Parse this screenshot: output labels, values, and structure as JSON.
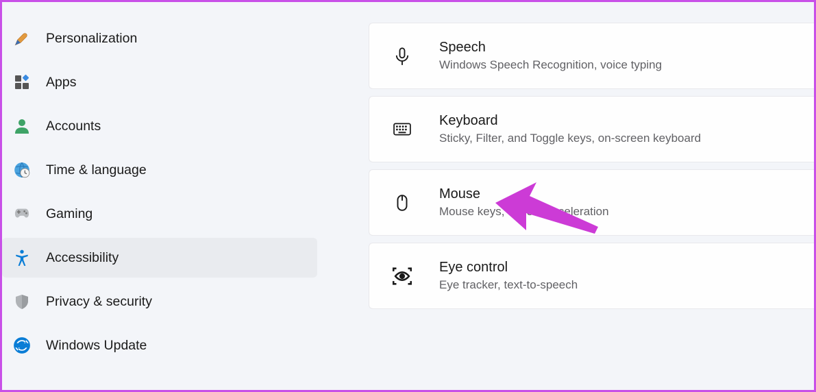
{
  "sidebar": {
    "items": [
      {
        "label": "Personalization",
        "selected": false
      },
      {
        "label": "Apps",
        "selected": false
      },
      {
        "label": "Accounts",
        "selected": false
      },
      {
        "label": "Time & language",
        "selected": false
      },
      {
        "label": "Gaming",
        "selected": false
      },
      {
        "label": "Accessibility",
        "selected": true
      },
      {
        "label": "Privacy & security",
        "selected": false
      },
      {
        "label": "Windows Update",
        "selected": false
      }
    ]
  },
  "main": {
    "cards": [
      {
        "title": "Speech",
        "subtitle": "Windows Speech Recognition, voice typing"
      },
      {
        "title": "Keyboard",
        "subtitle": "Sticky, Filter, and Toggle keys, on-screen keyboard"
      },
      {
        "title": "Mouse",
        "subtitle": "Mouse keys, speed, acceleration"
      },
      {
        "title": "Eye control",
        "subtitle": "Eye tracker, text-to-speech"
      }
    ]
  }
}
